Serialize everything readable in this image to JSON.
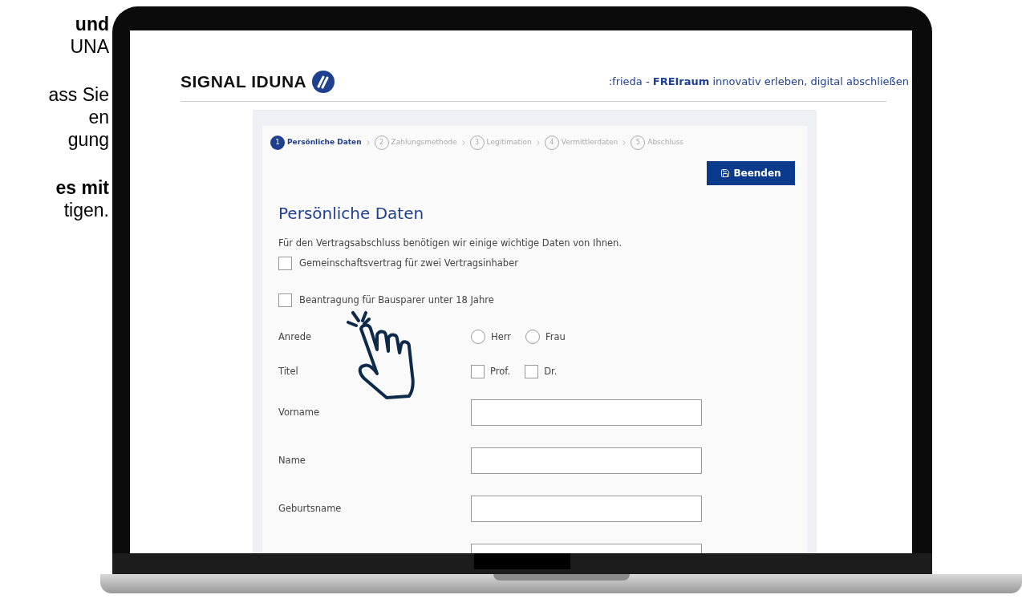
{
  "side_text": [
    {
      "text": "und",
      "bold": true
    },
    {
      "text": "UNA",
      "bold": false
    },
    {
      "text": "ass Sie",
      "bold": false
    },
    {
      "text": "en",
      "bold": false
    },
    {
      "text": "gung",
      "bold": false
    },
    {
      "text": "es mit",
      "bold": true
    },
    {
      "text": "tigen.",
      "bold": false
    }
  ],
  "header": {
    "logo": "SIGNAL IDUNA",
    "tagline": ":frieda - **FREIraum** innovativ erleben, digital abschließen"
  },
  "steps": [
    {
      "number": "1",
      "label": "Persönliche Daten",
      "selected": true
    },
    {
      "number": "2",
      "label": "Zahlungsmethode",
      "selected": false
    },
    {
      "number": "3",
      "label": "Legitimation",
      "selected": false
    },
    {
      "number": "4",
      "label": "Vermittlerdaten",
      "selected": false
    },
    {
      "number": "5",
      "label": "Abschluss",
      "selected": false
    }
  ],
  "finish_button": "Beenden",
  "form": {
    "title": "Persönliche Daten",
    "intro": "Für den Vertragsabschluss benötigen wir einige wichtige Daten von Ihnen.",
    "options": [
      {
        "label": "Gemeinschaftsvertrag für zwei Vertragsinhaber",
        "checked": false
      },
      {
        "label": "Beantragung für Bausparer unter 18 Jahre",
        "checked": false
      }
    ],
    "rows": [
      {
        "kind": "radio",
        "label": "Anrede",
        "choices": [
          {
            "label": "Herr",
            "selected": false
          },
          {
            "label": "Frau",
            "selected": false
          }
        ]
      },
      {
        "kind": "checkbox",
        "label": "Titel",
        "choices": [
          {
            "label": "Prof.",
            "checked": false
          },
          {
            "label": "Dr.",
            "checked": false
          }
        ]
      },
      {
        "kind": "text",
        "label": "Vorname"
      },
      {
        "kind": "text",
        "label": "Name"
      },
      {
        "kind": "text",
        "label": "Geburtsname"
      },
      {
        "kind": "text"
      }
    ]
  }
}
